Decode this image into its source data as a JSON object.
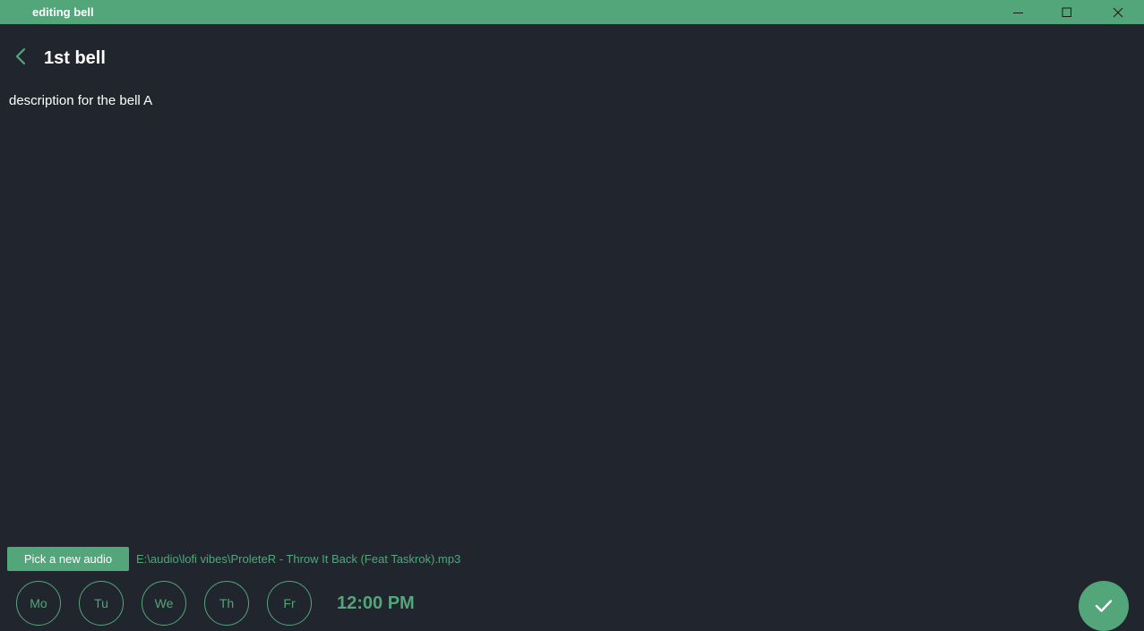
{
  "window": {
    "title": "editing bell",
    "titlebar_color": "#53a57a"
  },
  "header": {
    "back_icon": "chevron-left-icon",
    "title": "1st bell"
  },
  "description": "description for the bell A",
  "audio": {
    "pick_label": "Pick a new audio",
    "path": "E:\\audio\\lofi vibes\\ProleteR - Throw It Back (Feat Taskrok).mp3"
  },
  "days": [
    {
      "label": "Mo"
    },
    {
      "label": "Tu"
    },
    {
      "label": "We"
    },
    {
      "label": "Th"
    },
    {
      "label": "Fr"
    }
  ],
  "time": "12:00 PM",
  "confirm_icon": "checkmark-icon",
  "colors": {
    "background": "#21252d",
    "accent": "#53a57a",
    "text": "#ffffff"
  }
}
